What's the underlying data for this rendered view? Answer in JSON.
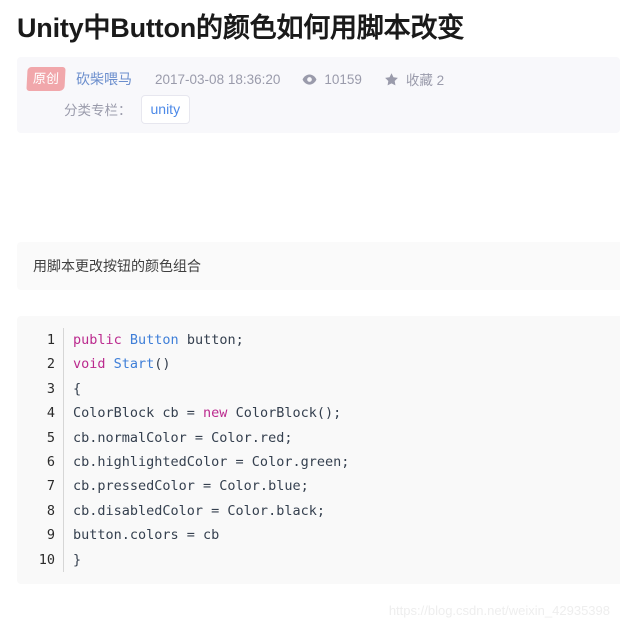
{
  "article": {
    "title": "Unity中Button的颜色如何用脚本改变",
    "meta": {
      "badge": "原创",
      "author": "砍柴喂马",
      "date": "2017-03-08 18:36:20",
      "views_icon": "eye-icon",
      "views": "10159",
      "collect_icon": "star-icon",
      "collect": "收藏 2",
      "category_label": "分类专栏：",
      "category_tag": "unity"
    },
    "body": {
      "paragraph": "用脚本更改按钮的颜色组合"
    },
    "code": {
      "language": "csharp",
      "lines": [
        {
          "num": "1",
          "tokens": [
            {
              "t": "public",
              "c": "kw"
            },
            {
              "t": " ",
              "c": "pl"
            },
            {
              "t": "Button",
              "c": "ty"
            },
            {
              "t": " button;",
              "c": "pl"
            }
          ]
        },
        {
          "num": "2",
          "tokens": [
            {
              "t": "void",
              "c": "kw"
            },
            {
              "t": " ",
              "c": "pl"
            },
            {
              "t": "Start",
              "c": "ty"
            },
            {
              "t": "()",
              "c": "pl"
            }
          ]
        },
        {
          "num": "3",
          "tokens": [
            {
              "t": "{",
              "c": "pl"
            }
          ]
        },
        {
          "num": "4",
          "tokens": [
            {
              "t": "ColorBlock cb = ",
              "c": "pl"
            },
            {
              "t": "new",
              "c": "kw"
            },
            {
              "t": " ColorBlock();",
              "c": "pl"
            }
          ]
        },
        {
          "num": "5",
          "tokens": [
            {
              "t": "cb.normalColor = Color.red;",
              "c": "pl"
            }
          ]
        },
        {
          "num": "6",
          "tokens": [
            {
              "t": "cb.highlightedColor = Color.green;",
              "c": "pl"
            }
          ]
        },
        {
          "num": "7",
          "tokens": [
            {
              "t": "cb.pressedColor = Color.blue;",
              "c": "pl"
            }
          ]
        },
        {
          "num": "8",
          "tokens": [
            {
              "t": "cb.disabledColor = Color.black;",
              "c": "pl"
            }
          ]
        },
        {
          "num": "9",
          "tokens": [
            {
              "t": "button.colors = cb",
              "c": "pl"
            }
          ]
        },
        {
          "num": "10",
          "tokens": [
            {
              "t": "}",
              "c": "pl"
            }
          ]
        }
      ]
    },
    "watermark": "https://blog.csdn.net/weixin_42935398"
  },
  "colors": {
    "badge_pink": "#f1a7ab",
    "author_blue": "#6b8ecd",
    "tag_blue": "#4d8ae8",
    "meta_gray": "#9a9bab",
    "keyword_magenta": "#bb2a8e",
    "type_blue": "#3f7fd8",
    "code_text": "#35404f",
    "meta_bg": "#f8f8fb",
    "code_bg": "#f9f9f9"
  }
}
